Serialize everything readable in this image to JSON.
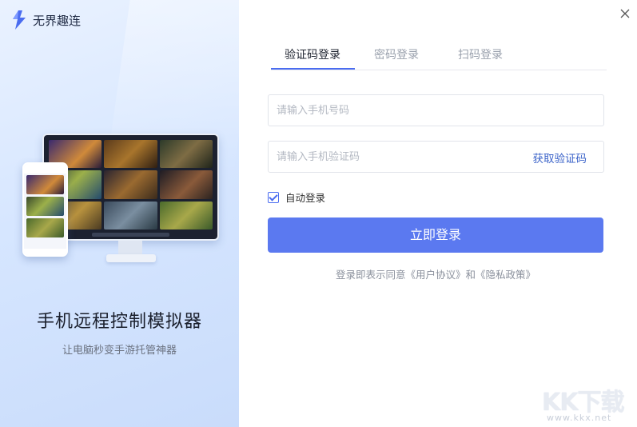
{
  "app": {
    "name": "无界趣连"
  },
  "promo": {
    "title": "手机远程控制模拟器",
    "subtitle": "让电脑秒变手游托管神器"
  },
  "tabs": [
    {
      "label": "验证码登录",
      "active": true
    },
    {
      "label": "密码登录",
      "active": false
    },
    {
      "label": "扫码登录",
      "active": false
    }
  ],
  "form": {
    "phone_placeholder": "请输入手机号码",
    "code_placeholder": "请输入手机验证码",
    "get_code_label": "获取验证码",
    "auto_login_label": "自动登录",
    "auto_login_checked": true,
    "login_button": "立即登录",
    "agreement_text": "登录即表示同意《用户协议》和《隐私政策》"
  },
  "watermark": {
    "big": "KK下载",
    "small": "www.kkx.net"
  },
  "colors": {
    "accent": "#5b79f0",
    "link": "#3b63c9",
    "tab_underline": "#4a6cf0"
  },
  "icons": {
    "brand": "lightning-logo-icon",
    "close": "close-icon",
    "checkbox": "checkbox-checked-icon"
  }
}
